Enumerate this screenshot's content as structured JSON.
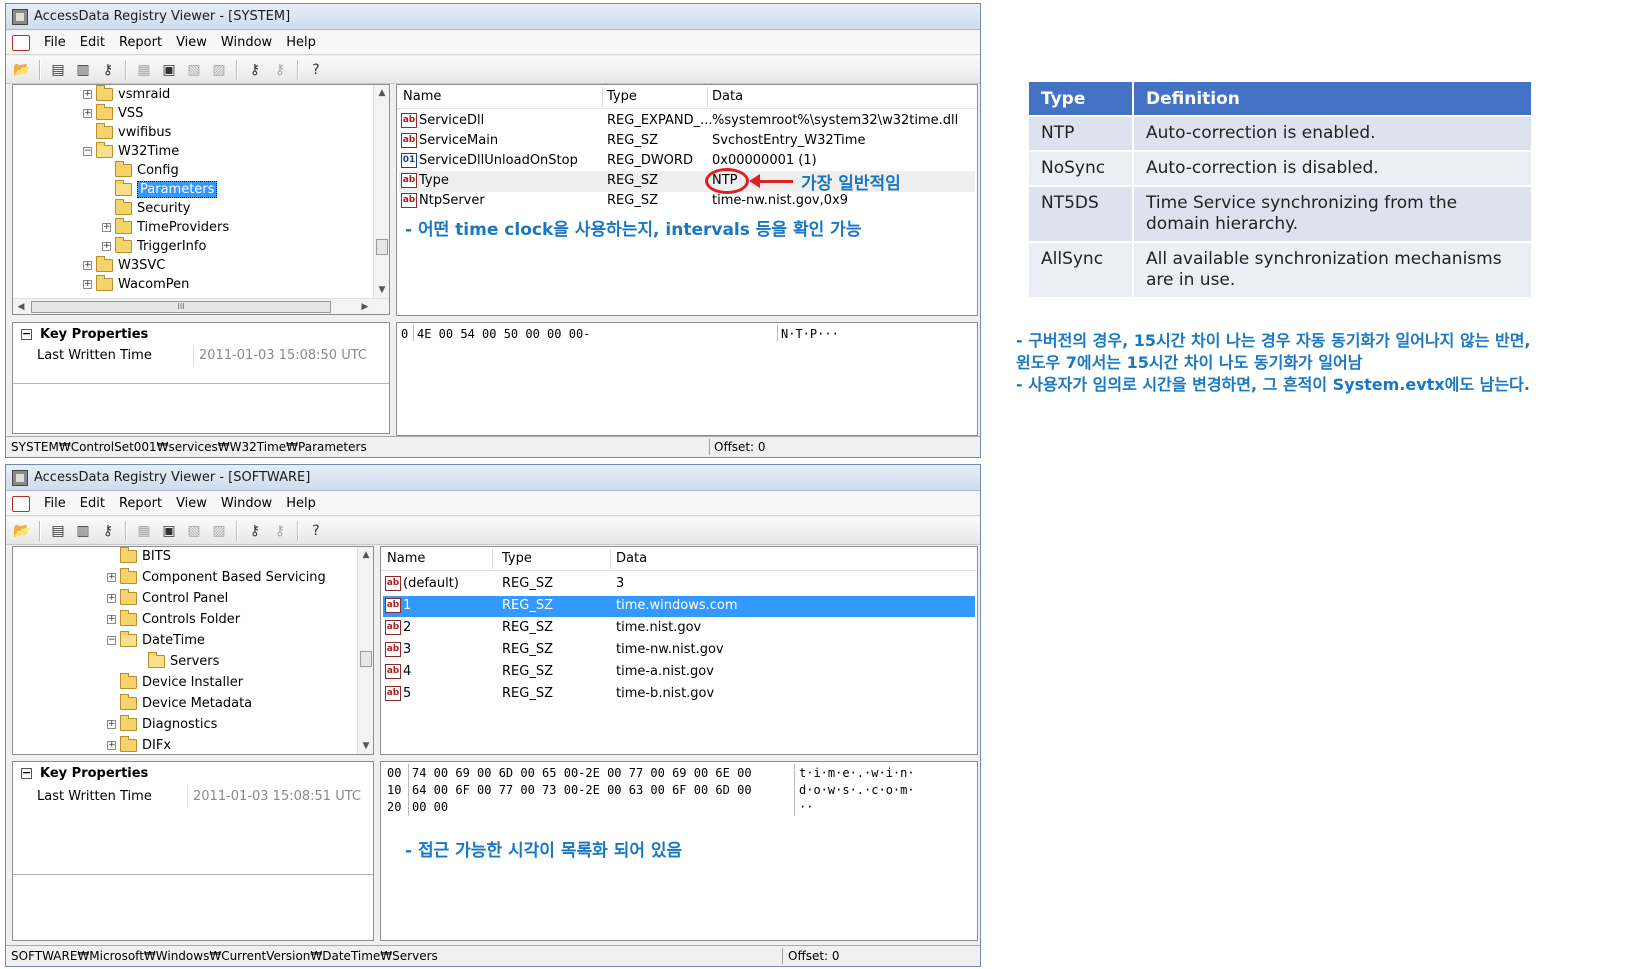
{
  "window1": {
    "title": "AccessData Registry Viewer - [SYSTEM]",
    "menu": [
      "File",
      "Edit",
      "Report",
      "View",
      "Window",
      "Help"
    ],
    "tree": [
      {
        "label": "vsmraid",
        "expander": "+",
        "indent": 0
      },
      {
        "label": "VSS",
        "expander": "+",
        "indent": 0
      },
      {
        "label": "vwifibus",
        "expander": "",
        "indent": 0
      },
      {
        "label": "W32Time",
        "expander": "-",
        "indent": 0
      },
      {
        "label": "Config",
        "expander": "",
        "indent": 1
      },
      {
        "label": "Parameters",
        "expander": "",
        "indent": 1,
        "selected": true
      },
      {
        "label": "Security",
        "expander": "",
        "indent": 1
      },
      {
        "label": "TimeProviders",
        "expander": "+",
        "indent": 1
      },
      {
        "label": "TriggerInfo",
        "expander": "+",
        "indent": 1
      },
      {
        "label": "W3SVC",
        "expander": "+",
        "indent": 0
      },
      {
        "label": "WacomPen",
        "expander": "+",
        "indent": 0
      }
    ],
    "hscroll_label": "III",
    "list_headers": {
      "name": "Name",
      "type": "Type",
      "data": "Data"
    },
    "rows": [
      {
        "icon": "ab",
        "name": "ServiceDll",
        "type": "REG_EXPAND_...",
        "data": "%systemroot%\\system32\\w32time.dll"
      },
      {
        "icon": "ab",
        "name": "ServiceMain",
        "type": "REG_SZ",
        "data": "SvchostEntry_W32Time"
      },
      {
        "icon": "dword",
        "name": "ServiceDllUnloadOnStop",
        "type": "REG_DWORD",
        "data": "0x00000001 (1)"
      },
      {
        "icon": "ab",
        "name": "Type",
        "type": "REG_SZ",
        "data": "NTP"
      },
      {
        "icon": "ab",
        "name": "NtpServer",
        "type": "REG_SZ",
        "data": "time-nw.nist.gov,0x9"
      }
    ],
    "annotation_common": "가장 일반적임",
    "annotation_list": "-  어떤 time clock을 사용하는지, intervals 등을 확인 가능",
    "key_properties": {
      "title": "Key Properties",
      "label": "Last Written Time",
      "value": "2011-01-03 15:08:50 UTC"
    },
    "hex": {
      "offsets": "0",
      "bytes": "4E 00 54 00 50 00 00 00-",
      "ascii": "N·T·P···"
    },
    "status": {
      "path": "SYSTEM₩ControlSet001₩services₩W32Time₩Parameters",
      "offset": "Offset: 0"
    }
  },
  "window2": {
    "title": "AccessData Registry Viewer - [SOFTWARE]",
    "menu": [
      "File",
      "Edit",
      "Report",
      "View",
      "Window",
      "Help"
    ],
    "tree": [
      {
        "label": "BITS",
        "expander": "",
        "indent": 0
      },
      {
        "label": "Component Based Servicing",
        "expander": "+",
        "indent": 0
      },
      {
        "label": "Control Panel",
        "expander": "+",
        "indent": 0
      },
      {
        "label": "Controls Folder",
        "expander": "+",
        "indent": 0
      },
      {
        "label": "DateTime",
        "expander": "-",
        "indent": 0
      },
      {
        "label": "Servers",
        "expander": "",
        "indent": 1
      },
      {
        "label": "Device Installer",
        "expander": "",
        "indent": 0
      },
      {
        "label": "Device Metadata",
        "expander": "",
        "indent": 0
      },
      {
        "label": "Diagnostics",
        "expander": "+",
        "indent": 0
      },
      {
        "label": "DIFx",
        "expander": "+",
        "indent": 0
      }
    ],
    "list_headers": {
      "name": "Name",
      "type": "Type",
      "data": "Data"
    },
    "rows": [
      {
        "name": "(default)",
        "type": "REG_SZ",
        "data": "3"
      },
      {
        "name": "1",
        "type": "REG_SZ",
        "data": "time.windows.com",
        "selected": true
      },
      {
        "name": "2",
        "type": "REG_SZ",
        "data": "time.nist.gov"
      },
      {
        "name": "3",
        "type": "REG_SZ",
        "data": "time-nw.nist.gov"
      },
      {
        "name": "4",
        "type": "REG_SZ",
        "data": "time-a.nist.gov"
      },
      {
        "name": "5",
        "type": "REG_SZ",
        "data": "time-b.nist.gov"
      }
    ],
    "key_properties": {
      "title": "Key Properties",
      "label": "Last Written Time",
      "value": "2011-01-03 15:08:51 UTC"
    },
    "hex": {
      "offsets": [
        "00",
        "10",
        "20"
      ],
      "bytes": [
        "74 00 69 00 6D 00 65 00-2E 00 77 00 69 00 6E 00",
        "64 00 6F 00 77 00 73 00-2E 00 63 00 6F 00 6D 00",
        "00 00"
      ],
      "ascii": [
        "t·i·m·e·.·w·i·n·",
        "d·o·w·s·.·c·o·m·",
        "··"
      ]
    },
    "annotation": "-  접근 가능한 시각이 목록화 되어 있음",
    "status": {
      "path": "SOFTWARE₩Microsoft₩Windows₩CurrentVersion₩DateTime₩Servers",
      "offset": "Offset: 0"
    }
  },
  "definition_table": {
    "headers": [
      "Type",
      "Definition"
    ],
    "rows": [
      [
        "NTP",
        "Auto-correction is enabled."
      ],
      [
        "NoSync",
        "Auto-correction is disabled."
      ],
      [
        "NT5DS",
        "Time Service synchronizing from the domain hierarchy."
      ],
      [
        "AllSync",
        "All available synchronization mechanisms are in use."
      ]
    ]
  },
  "notes": [
    "-   구버전의 경우, 15시간 차이 나는 경우 자동 동기화가 일어나지 않는 반면,",
    "윈도우 7에서는 15시간 차이 나도 동기화가 일어남",
    "-   사용자가 임의로 시간을 변경하면, 그 흔적이 System.evtx에도 남는다."
  ],
  "colors": {
    "accent": "#4472c4",
    "annotation": "#1a78c2",
    "selection": "#3399ff",
    "circle": "#e02020"
  }
}
